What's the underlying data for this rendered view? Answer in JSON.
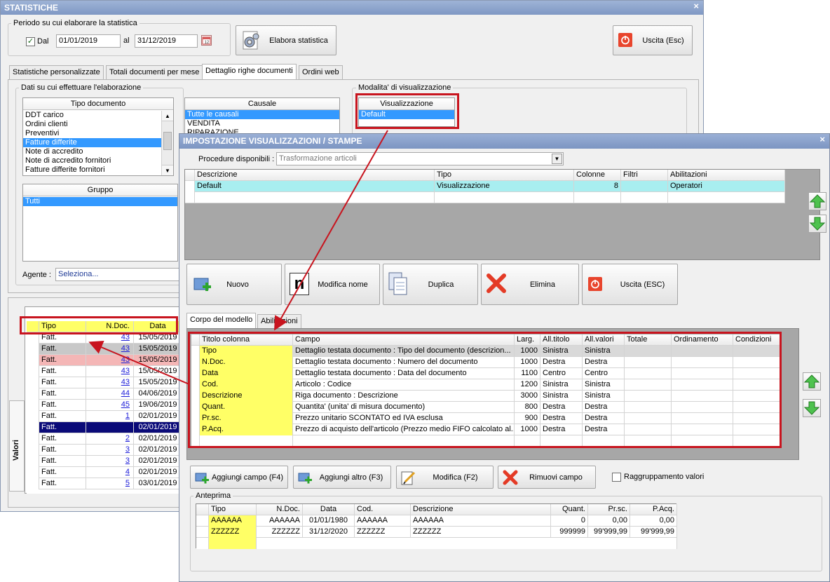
{
  "main_window": {
    "title": "STATISTICHE",
    "close": "×",
    "period_group": "Periodo su cui elaborare la statistica",
    "dal_label": "Dal",
    "date_from": "01/01/2019",
    "al_label": "al",
    "date_to": "31/12/2019",
    "elabora_label": "Elabora statistica",
    "uscita_label": "Uscita (Esc)",
    "tabs": [
      "Statistiche personalizzate",
      "Totali documenti per mese",
      "Dettaglio righe documenti",
      "Ordini web"
    ],
    "data_group": "Dati su cui effettuare l'elaborazione",
    "tipo_doc_header": "Tipo documento",
    "tipo_doc_items": [
      "DDT carico",
      "Ordini clienti",
      "Preventivi",
      "Fatture differite",
      "Note di accredito",
      "Note di accredito fornitori",
      "Fatture differite fornitori"
    ],
    "causale_header": "Causale",
    "causale_items": [
      "Tutte le causali",
      "VENDITA",
      "RIPARAZIONE"
    ],
    "gruppo_header": "Gruppo",
    "gruppo_items": [
      "Tutti"
    ],
    "agente_label": "Agente :",
    "agente_value": "Seleziona...",
    "modalita_group": "Modalita' di visualizzazione",
    "visualizzazione_header": "Visualizzazione",
    "visualizzazione_items": [
      "Default"
    ],
    "valori_tab": "Valori",
    "result_headers": [
      "Tipo",
      "N.Doc.",
      "Data"
    ],
    "result_rows": [
      {
        "tipo": "Fatt.",
        "ndoc": "43",
        "data": "15/05/2019"
      },
      {
        "tipo": "Fatt.",
        "ndoc": "43",
        "data": "15/05/2019"
      },
      {
        "tipo": "Fatt.",
        "ndoc": "43",
        "data": "15/05/2019"
      },
      {
        "tipo": "Fatt.",
        "ndoc": "43",
        "data": "15/05/2019"
      },
      {
        "tipo": "Fatt.",
        "ndoc": "43",
        "data": "15/05/2019"
      },
      {
        "tipo": "Fatt.",
        "ndoc": "44",
        "data": "04/06/2019"
      },
      {
        "tipo": "Fatt.",
        "ndoc": "45",
        "data": "19/06/2019"
      },
      {
        "tipo": "Fatt.",
        "ndoc": "1",
        "data": "02/01/2019"
      },
      {
        "tipo": "Fatt.",
        "ndoc": "",
        "data": "02/01/2019"
      },
      {
        "tipo": "Fatt.",
        "ndoc": "2",
        "data": "02/01/2019"
      },
      {
        "tipo": "Fatt.",
        "ndoc": "3",
        "data": "02/01/2019"
      },
      {
        "tipo": "Fatt.",
        "ndoc": "3",
        "data": "02/01/2019"
      },
      {
        "tipo": "Fatt.",
        "ndoc": "4",
        "data": "02/01/2019"
      },
      {
        "tipo": "Fatt.",
        "ndoc": "5",
        "data": "03/01/2019"
      }
    ]
  },
  "dialog": {
    "title": "IMPOSTAZIONE VISUALIZZAZIONI / STAMPE",
    "close": "×",
    "procedure_label": "Procedure disponibili :",
    "procedure_value": "Trasformazione articoli",
    "models_headers": [
      "Descrizione",
      "Tipo",
      "Colonne",
      "Filtri",
      "Abilitazioni"
    ],
    "models_rows": [
      {
        "descrizione": "Default",
        "tipo": "Visualizzazione",
        "colonne": "8",
        "filtri": "",
        "abilitazioni": "Operatori"
      }
    ],
    "buttons": {
      "nuovo": "Nuovo",
      "modifica_nome": "Modifica nome",
      "duplica": "Duplica",
      "elimina": "Elimina",
      "uscita": "Uscita (ESC)"
    },
    "tabs": [
      "Corpo del modello",
      "Abilitazioni"
    ],
    "columns_headers": [
      "Titolo colonna",
      "Campo",
      "Larg.",
      "All.titolo",
      "All.valori",
      "Totale",
      "Ordinamento",
      "Condizioni"
    ],
    "columns_rows": [
      {
        "titolo": "Tipo",
        "campo": "Dettaglio testata documento : Tipo del documento (descrizion...",
        "larg": "1000",
        "alltitolo": "Sinistra",
        "allvalori": "Sinistra"
      },
      {
        "titolo": "N.Doc.",
        "campo": "Dettaglio testata documento : Numero del documento",
        "larg": "1000",
        "alltitolo": "Destra",
        "allvalori": "Destra"
      },
      {
        "titolo": "Data",
        "campo": "Dettaglio testata documento : Data del documento",
        "larg": "1100",
        "alltitolo": "Centro",
        "allvalori": "Centro"
      },
      {
        "titolo": "Cod.",
        "campo": "Articolo : Codice",
        "larg": "1200",
        "alltitolo": "Sinistra",
        "allvalori": "Sinistra"
      },
      {
        "titolo": "Descrizione",
        "campo": "Riga documento : Descrizione",
        "larg": "3000",
        "alltitolo": "Sinistra",
        "allvalori": "Sinistra"
      },
      {
        "titolo": "Quant.",
        "campo": "Quantita' (unita' di misura documento)",
        "larg": "800",
        "alltitolo": "Destra",
        "allvalori": "Destra"
      },
      {
        "titolo": "Pr.sc.",
        "campo": "Prezzo unitario SCONTATO ed IVA esclusa",
        "larg": "900",
        "alltitolo": "Destra",
        "allvalori": "Destra"
      },
      {
        "titolo": "P.Acq.",
        "campo": "Prezzo di acquisto dell'articolo (Prezzo medio FIFO calcolato al...",
        "larg": "1000",
        "alltitolo": "Destra",
        "allvalori": "Destra"
      }
    ],
    "field_buttons": {
      "aggiungi_campo": "Aggiungi campo (F4)",
      "aggiungi_altro": "Aggiungi altro (F3)",
      "modifica": "Modifica (F2)",
      "rimuovi": "Rimuovi campo"
    },
    "raggruppamento_label": "Raggruppamento valori",
    "anteprima_label": "Anteprima",
    "preview_headers": [
      "Tipo",
      "N.Doc.",
      "Data",
      "Cod.",
      "Descrizione",
      "Quant.",
      "Pr.sc.",
      "P.Acq."
    ],
    "preview_rows": [
      [
        "AAAAAA",
        "AAAAAA",
        "01/01/1980",
        "AAAAAA",
        "AAAAAA",
        "0",
        "0,00",
        "0,00"
      ],
      [
        "ZZZZZZ",
        "ZZZZZZ",
        "31/12/2020",
        "ZZZZZZ",
        "ZZZZZZ",
        "999999",
        "99'999,99",
        "99'999,99"
      ]
    ]
  },
  "colors": {
    "highlight": "#c8141e",
    "yellow": "#ffff66",
    "selection": "#3399ff",
    "title_bar": "#8ea6cf",
    "teal_row": "#a8eef0"
  }
}
